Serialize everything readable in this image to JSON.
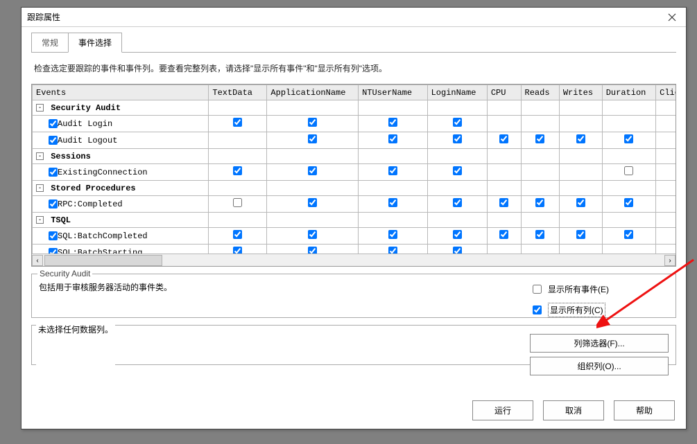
{
  "window": {
    "title": "跟踪属性"
  },
  "tabs": {
    "general": "常规",
    "events": "事件选择"
  },
  "helper": "检查选定要跟踪的事件和事件列。要查看完整列表，请选择\"显示所有事件\"和\"显示所有列\"选项。",
  "grid": {
    "headers": [
      "Events",
      "TextData",
      "ApplicationName",
      "NTUserName",
      "LoginName",
      "CPU",
      "Reads",
      "Writes",
      "Duration",
      "ClientProce"
    ],
    "groups": [
      {
        "name": "Security Audit",
        "rows": [
          {
            "label": "Audit Login",
            "checks": {
              "ev": true,
              "TextData": true,
              "ApplicationName": true,
              "NTUserName": true,
              "LoginName": true,
              "CPU": null,
              "Reads": null,
              "Writes": null,
              "Duration": null,
              "ClientProce": true
            }
          },
          {
            "label": "Audit Logout",
            "checks": {
              "ev": true,
              "TextData": null,
              "ApplicationName": true,
              "NTUserName": true,
              "LoginName": true,
              "CPU": true,
              "Reads": true,
              "Writes": true,
              "Duration": true,
              "ClientProce": true
            }
          }
        ]
      },
      {
        "name": "Sessions",
        "rows": [
          {
            "label": "ExistingConnection",
            "checks": {
              "ev": true,
              "TextData": true,
              "ApplicationName": true,
              "NTUserName": true,
              "LoginName": true,
              "CPU": null,
              "Reads": null,
              "Writes": null,
              "Duration": false,
              "ClientProce": true
            }
          }
        ]
      },
      {
        "name": "Stored Procedures",
        "rows": [
          {
            "label": "RPC:Completed",
            "checks": {
              "ev": true,
              "TextData": false,
              "ApplicationName": true,
              "NTUserName": true,
              "LoginName": true,
              "CPU": true,
              "Reads": true,
              "Writes": true,
              "Duration": true,
              "ClientProce": true
            }
          }
        ]
      },
      {
        "name": "TSQL",
        "rows": [
          {
            "label": "SQL:BatchCompleted",
            "checks": {
              "ev": true,
              "TextData": true,
              "ApplicationName": true,
              "NTUserName": true,
              "LoginName": true,
              "CPU": true,
              "Reads": true,
              "Writes": true,
              "Duration": true,
              "ClientProce": true
            }
          },
          {
            "label": "SQL:BatchStarting",
            "checks": {
              "ev": true,
              "TextData": true,
              "ApplicationName": true,
              "NTUserName": true,
              "LoginName": true,
              "CPU": null,
              "Reads": null,
              "Writes": null,
              "Duration": null,
              "ClientProce": true
            }
          }
        ]
      }
    ]
  },
  "desc": {
    "legend": "Security Audit",
    "text": "包括用于审核服务器活动的事件类。"
  },
  "options": {
    "show_all_events": "显示所有事件(E)",
    "show_all_columns": "显示所有列(C)"
  },
  "nocolumn": "未选择任何数据列。",
  "rightButtons": {
    "filter": "列筛选器(F)...",
    "organize": "组织列(O)..."
  },
  "buttons": {
    "run": "运行",
    "cancel": "取消",
    "help": "帮助"
  }
}
